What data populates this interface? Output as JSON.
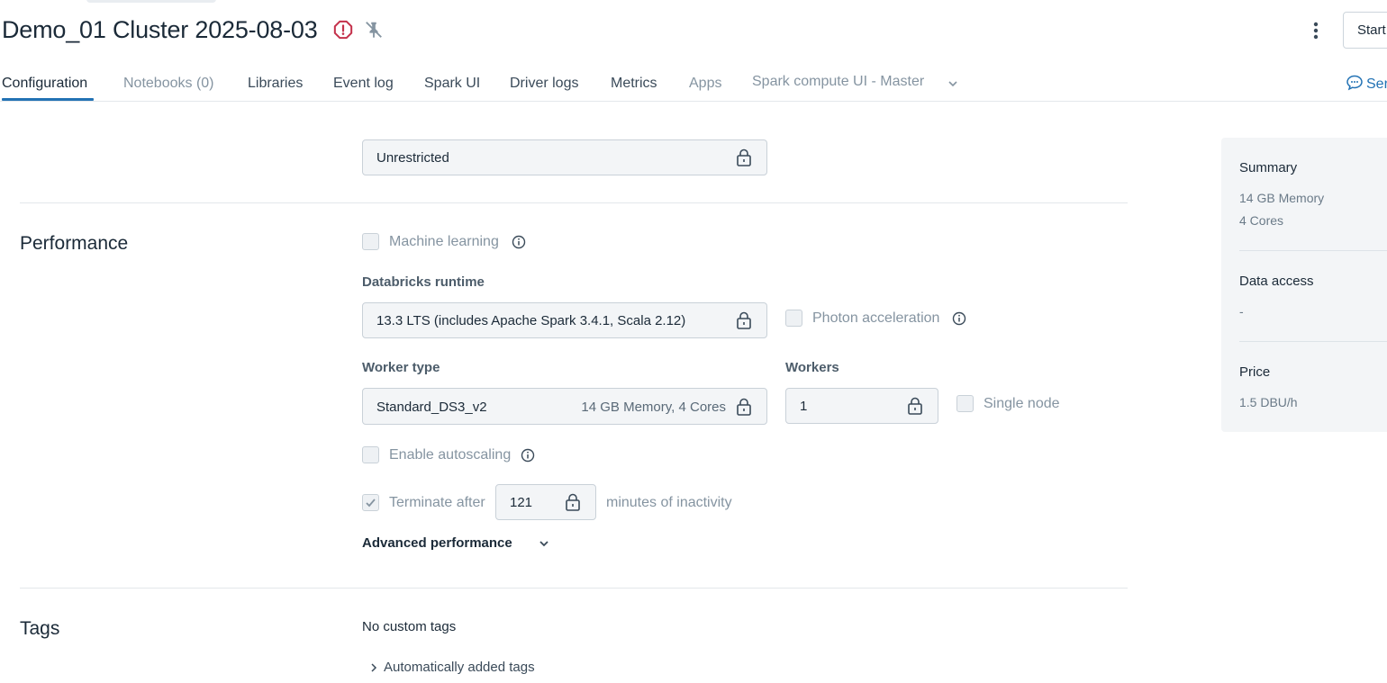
{
  "page": {
    "title": "Demo_01 Cluster 2025-08-03",
    "start_label": "Start"
  },
  "tabs": [
    {
      "label": "Configuration"
    },
    {
      "label": "Notebooks (0)"
    },
    {
      "label": "Libraries"
    },
    {
      "label": "Event log"
    },
    {
      "label": "Spark UI"
    },
    {
      "label": "Driver logs"
    },
    {
      "label": "Metrics"
    },
    {
      "label": "Apps"
    },
    {
      "label": "Spark compute UI - Master"
    }
  ],
  "feedback_label": "Ser",
  "access": {
    "policy_value": "Unrestricted"
  },
  "performance": {
    "section_title": "Performance",
    "machine_learning_label": "Machine learning",
    "runtime_label": "Databricks runtime",
    "runtime_value": "13.3 LTS (includes Apache Spark 3.4.1, Scala 2.12)",
    "photon_label": "Photon acceleration",
    "worker_type_label": "Worker type",
    "worker_type_value": "Standard_DS3_v2",
    "worker_type_meta": "14 GB Memory, 4 Cores",
    "workers_label": "Workers",
    "workers_value": "1",
    "single_node_label": "Single node",
    "autoscaling_label": "Enable autoscaling",
    "terminate_label": "Terminate after",
    "terminate_value": "121",
    "terminate_suffix": "minutes of inactivity",
    "advanced_label": "Advanced performance"
  },
  "tags": {
    "section_title": "Tags",
    "no_tags_text": "No custom tags",
    "auto_tags_label": "Automatically added tags"
  },
  "summary": {
    "title": "Summary",
    "memory": "14 GB Memory",
    "cores": "4 Cores",
    "data_access_title": "Data access",
    "data_access_value": "-",
    "price_title": "Price",
    "price_value": "1.5 DBU/h"
  },
  "colors": {
    "accent": "#2272b4",
    "alert": "#c4314b"
  }
}
